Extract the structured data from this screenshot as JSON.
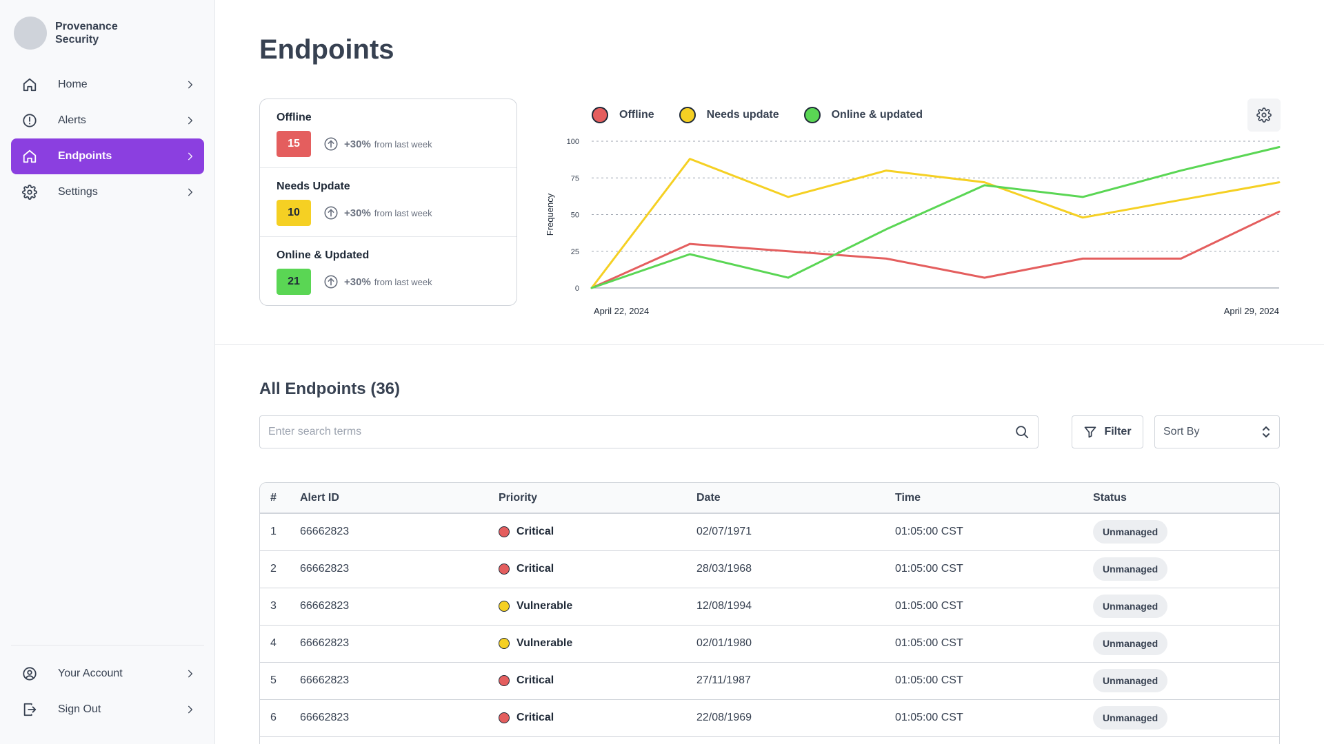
{
  "brand": {
    "name": "Provenance Security"
  },
  "nav": {
    "items": [
      {
        "label": "Home",
        "icon": "home-icon"
      },
      {
        "label": "Alerts",
        "icon": "alert-circle-icon"
      },
      {
        "label": "Endpoints",
        "icon": "home-icon",
        "active": true
      },
      {
        "label": "Settings",
        "icon": "gear-icon"
      }
    ],
    "bottom": [
      {
        "label": "Your Account",
        "icon": "user-circle-icon"
      },
      {
        "label": "Sign Out",
        "icon": "sign-out-icon"
      }
    ]
  },
  "page": {
    "title": "Endpoints"
  },
  "stats": [
    {
      "label": "Offline",
      "value": "15",
      "change": "+30%",
      "sub": "from last week",
      "color": "#e45e5e"
    },
    {
      "label": "Needs Update",
      "value": "10",
      "change": "+30%",
      "sub": "from last week",
      "color": "#f5d023"
    },
    {
      "label": "Online & Updated",
      "value": "21",
      "change": "+30%",
      "sub": "from last week",
      "color": "#5ad654"
    }
  ],
  "colors": {
    "accent": "#8b3fe0",
    "offline": "#e45e5e",
    "needs_update": "#f5d023",
    "online": "#5ad654"
  },
  "chart_data": {
    "type": "line",
    "ylabel": "Frequency",
    "xlabel": "",
    "x_tick_labels": [
      "April 22, 2024",
      "April 29, 2024"
    ],
    "x": [
      "April 22, 2024",
      "April 23, 2024",
      "April 24, 2024",
      "April 25, 2024",
      "April 26, 2024",
      "April 27, 2024",
      "April 28, 2024",
      "April 29, 2024"
    ],
    "ylim": [
      0,
      100
    ],
    "yticks": [
      0,
      25,
      50,
      75,
      100
    ],
    "grid": true,
    "legend_position": "top-left",
    "series": [
      {
        "name": "Offline",
        "color": "#e45e5e",
        "values": [
          0,
          30,
          25,
          20,
          7,
          20,
          20,
          52
        ]
      },
      {
        "name": "Needs update",
        "color": "#f5d023",
        "values": [
          0,
          88,
          62,
          80,
          72,
          48,
          60,
          72
        ]
      },
      {
        "name": "Online & updated",
        "color": "#5ad654",
        "values": [
          0,
          23,
          7,
          40,
          70,
          62,
          80,
          96
        ]
      }
    ]
  },
  "table": {
    "title": "All Endpoints (36)",
    "search_placeholder": "Enter search terms",
    "filter_label": "Filter",
    "sort_label": "Sort By",
    "columns": [
      "#",
      "Alert ID",
      "Priority",
      "Date",
      "Time",
      "Status"
    ],
    "rows": [
      {
        "num": "1",
        "id": "66662823",
        "priority": "Critical",
        "priority_color": "#e45e5e",
        "date": "02/07/1971",
        "time": "01:05:00 CST",
        "status": "Unmanaged"
      },
      {
        "num": "2",
        "id": "66662823",
        "priority": "Critical",
        "priority_color": "#e45e5e",
        "date": "28/03/1968",
        "time": "01:05:00 CST",
        "status": "Unmanaged"
      },
      {
        "num": "3",
        "id": "66662823",
        "priority": "Vulnerable",
        "priority_color": "#f5d023",
        "date": "12/08/1994",
        "time": "01:05:00 CST",
        "status": "Unmanaged"
      },
      {
        "num": "4",
        "id": "66662823",
        "priority": "Vulnerable",
        "priority_color": "#f5d023",
        "date": "02/01/1980",
        "time": "01:05:00 CST",
        "status": "Unmanaged"
      },
      {
        "num": "5",
        "id": "66662823",
        "priority": "Critical",
        "priority_color": "#e45e5e",
        "date": "27/11/1987",
        "time": "01:05:00 CST",
        "status": "Unmanaged"
      },
      {
        "num": "6",
        "id": "66662823",
        "priority": "Critical",
        "priority_color": "#e45e5e",
        "date": "22/08/1969",
        "time": "01:05:00 CST",
        "status": "Unmanaged"
      }
    ]
  }
}
